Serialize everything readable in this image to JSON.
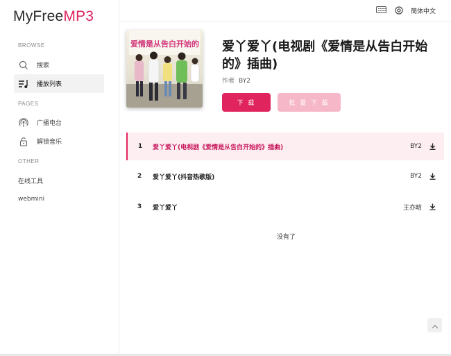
{
  "app": {
    "logo_part1": "MyFree",
    "logo_part2": "MP3"
  },
  "topbar": {
    "language": "簡体中文",
    "keyboard_icon": "keyboard-icon",
    "settings_icon": "gear-icon"
  },
  "sidebar": {
    "browse_label": "BROWSE",
    "pages_label": "PAGES",
    "other_label": "OTHER",
    "browse_items": [
      {
        "label": "搜索",
        "icon": "search-icon"
      },
      {
        "label": "播放列表",
        "icon": "playlist-icon"
      }
    ],
    "pages_items": [
      {
        "label": "广播电台",
        "icon": "radio-icon"
      },
      {
        "label": "解锁音乐",
        "icon": "unlock-icon"
      }
    ],
    "other_items": [
      {
        "label": "在线工具"
      },
      {
        "label": "webmini"
      }
    ]
  },
  "album": {
    "title": "爱丫爱丫(电视剧《爱情是从告白开始的》插曲)",
    "author_label": "作者",
    "author": "BY2",
    "download_label": "下 载",
    "batch_download_label": "批 量 下 载"
  },
  "tracks": [
    {
      "num": "1",
      "name": "爱丫爱丫(电视剧《爱情是从告白开始的》插曲)",
      "artist": "BY2"
    },
    {
      "num": "2",
      "name": "爱丫爱丫(抖音热歌版)",
      "artist": "BY2"
    },
    {
      "num": "3",
      "name": "爱丫爱丫",
      "artist": "王亦晗"
    }
  ],
  "list_end": "没有了",
  "colors": {
    "accent": "#e0245e",
    "accent_light": "#f6b7c8",
    "active_row": "#fdeef2"
  }
}
